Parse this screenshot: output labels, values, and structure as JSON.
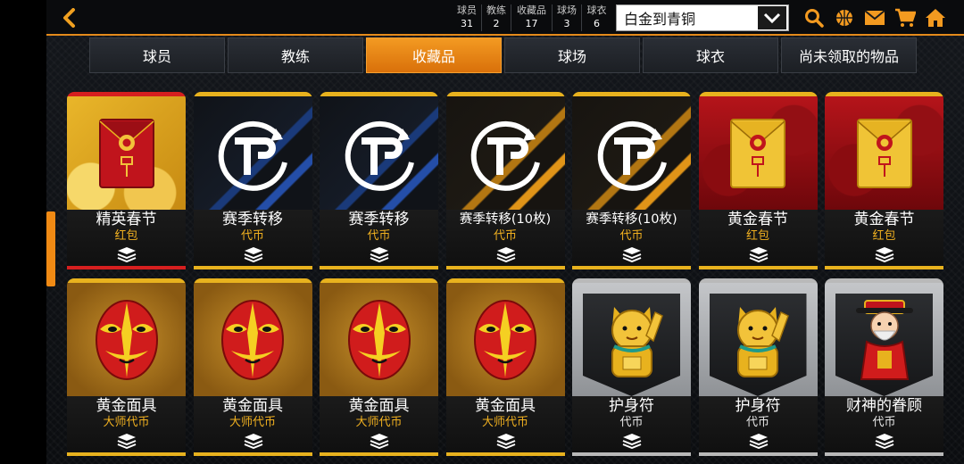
{
  "header": {
    "back_icon": "chevron-left-icon",
    "counts": [
      {
        "label": "球员",
        "value": "31"
      },
      {
        "label": "教练",
        "value": "2"
      },
      {
        "label": "收藏品",
        "value": "17"
      },
      {
        "label": "球场",
        "value": "3"
      },
      {
        "label": "球衣",
        "value": "6"
      }
    ],
    "filter": {
      "selected": "白金到青铜"
    },
    "icons": [
      "search-icon",
      "basketball-icon",
      "mail-icon",
      "cart-icon",
      "home-icon"
    ],
    "accent": "#e48a1b"
  },
  "tabs": [
    {
      "label": "球员",
      "active": false
    },
    {
      "label": "教练",
      "active": false
    },
    {
      "label": "收藏品",
      "active": true
    },
    {
      "label": "球场",
      "active": false
    },
    {
      "label": "球衣",
      "active": false
    },
    {
      "label": "尚未领取的物品",
      "active": false
    }
  ],
  "items": [
    {
      "name": "精英春节",
      "sub": "红包",
      "art": "red-envelope-icon"
    },
    {
      "name": "赛季转移",
      "sub": "代币",
      "art": "tp-token-icon"
    },
    {
      "name": "赛季转移",
      "sub": "代币",
      "art": "tp-token-icon"
    },
    {
      "name": "赛季转移(10枚)",
      "sub": "代币",
      "art": "tp-token-icon"
    },
    {
      "name": "赛季转移(10枚)",
      "sub": "代币",
      "art": "tp-token-icon"
    },
    {
      "name": "黄金春节",
      "sub": "红包",
      "art": "gold-envelope-icon"
    },
    {
      "name": "黄金春节",
      "sub": "红包",
      "art": "gold-envelope-icon"
    },
    {
      "name": "黄金面具",
      "sub": "大师代币",
      "art": "opera-mask-icon"
    },
    {
      "name": "黄金面具",
      "sub": "大师代币",
      "art": "opera-mask-icon"
    },
    {
      "name": "黄金面具",
      "sub": "大师代币",
      "art": "opera-mask-icon"
    },
    {
      "name": "黄金面具",
      "sub": "大师代币",
      "art": "opera-mask-icon"
    },
    {
      "name": "护身符",
      "sub": "代币",
      "art": "lucky-cat-icon"
    },
    {
      "name": "护身符",
      "sub": "代币",
      "art": "lucky-cat-icon"
    },
    {
      "name": "财神的眷顾",
      "sub": "代币",
      "art": "fortune-god-icon"
    }
  ]
}
